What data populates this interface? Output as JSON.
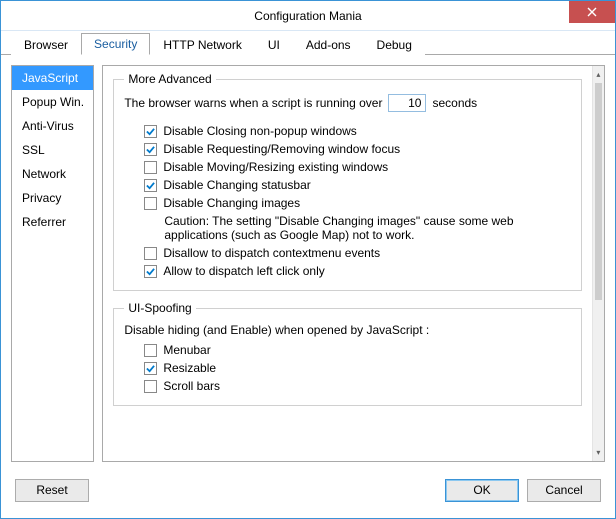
{
  "window": {
    "title": "Configuration Mania"
  },
  "tabs": {
    "browser": "Browser",
    "security": "Security",
    "http": "HTTP Network",
    "ui": "UI",
    "addons": "Add-ons",
    "debug": "Debug",
    "active": "security"
  },
  "sidebar": {
    "items": [
      "JavaScript",
      "Popup Win.",
      "Anti-Virus",
      "SSL",
      "Network",
      "Privacy",
      "Referrer"
    ],
    "selected": 0
  },
  "group_more": {
    "legend": "More Advanced",
    "warn_prefix": "The browser warns when a script is running over",
    "warn_value": "10",
    "warn_suffix": "seconds",
    "opts": [
      {
        "label": "Disable Closing non-popup windows",
        "checked": true
      },
      {
        "label": "Disable Requesting/Removing window focus",
        "checked": true
      },
      {
        "label": "Disable Moving/Resizing existing windows",
        "checked": false
      },
      {
        "label": "Disable Changing statusbar",
        "checked": true
      },
      {
        "label": "Disable Changing images",
        "checked": false
      }
    ],
    "caution": "Caution: The setting \"Disable Changing images\" cause some web applications (such as Google Map) not to work.",
    "opts2": [
      {
        "label": "Disallow to dispatch contextmenu events",
        "checked": false
      },
      {
        "label": "Allow to dispatch left click only",
        "checked": true
      }
    ]
  },
  "group_spoof": {
    "legend": "UI-Spoofing",
    "desc": "Disable hiding (and Enable) when opened by JavaScript :",
    "opts": [
      {
        "label": "Menubar",
        "checked": false
      },
      {
        "label": "Resizable",
        "checked": true
      },
      {
        "label": "Scroll bars",
        "checked": false
      }
    ]
  },
  "footer": {
    "reset": "Reset",
    "ok": "OK",
    "cancel": "Cancel"
  }
}
